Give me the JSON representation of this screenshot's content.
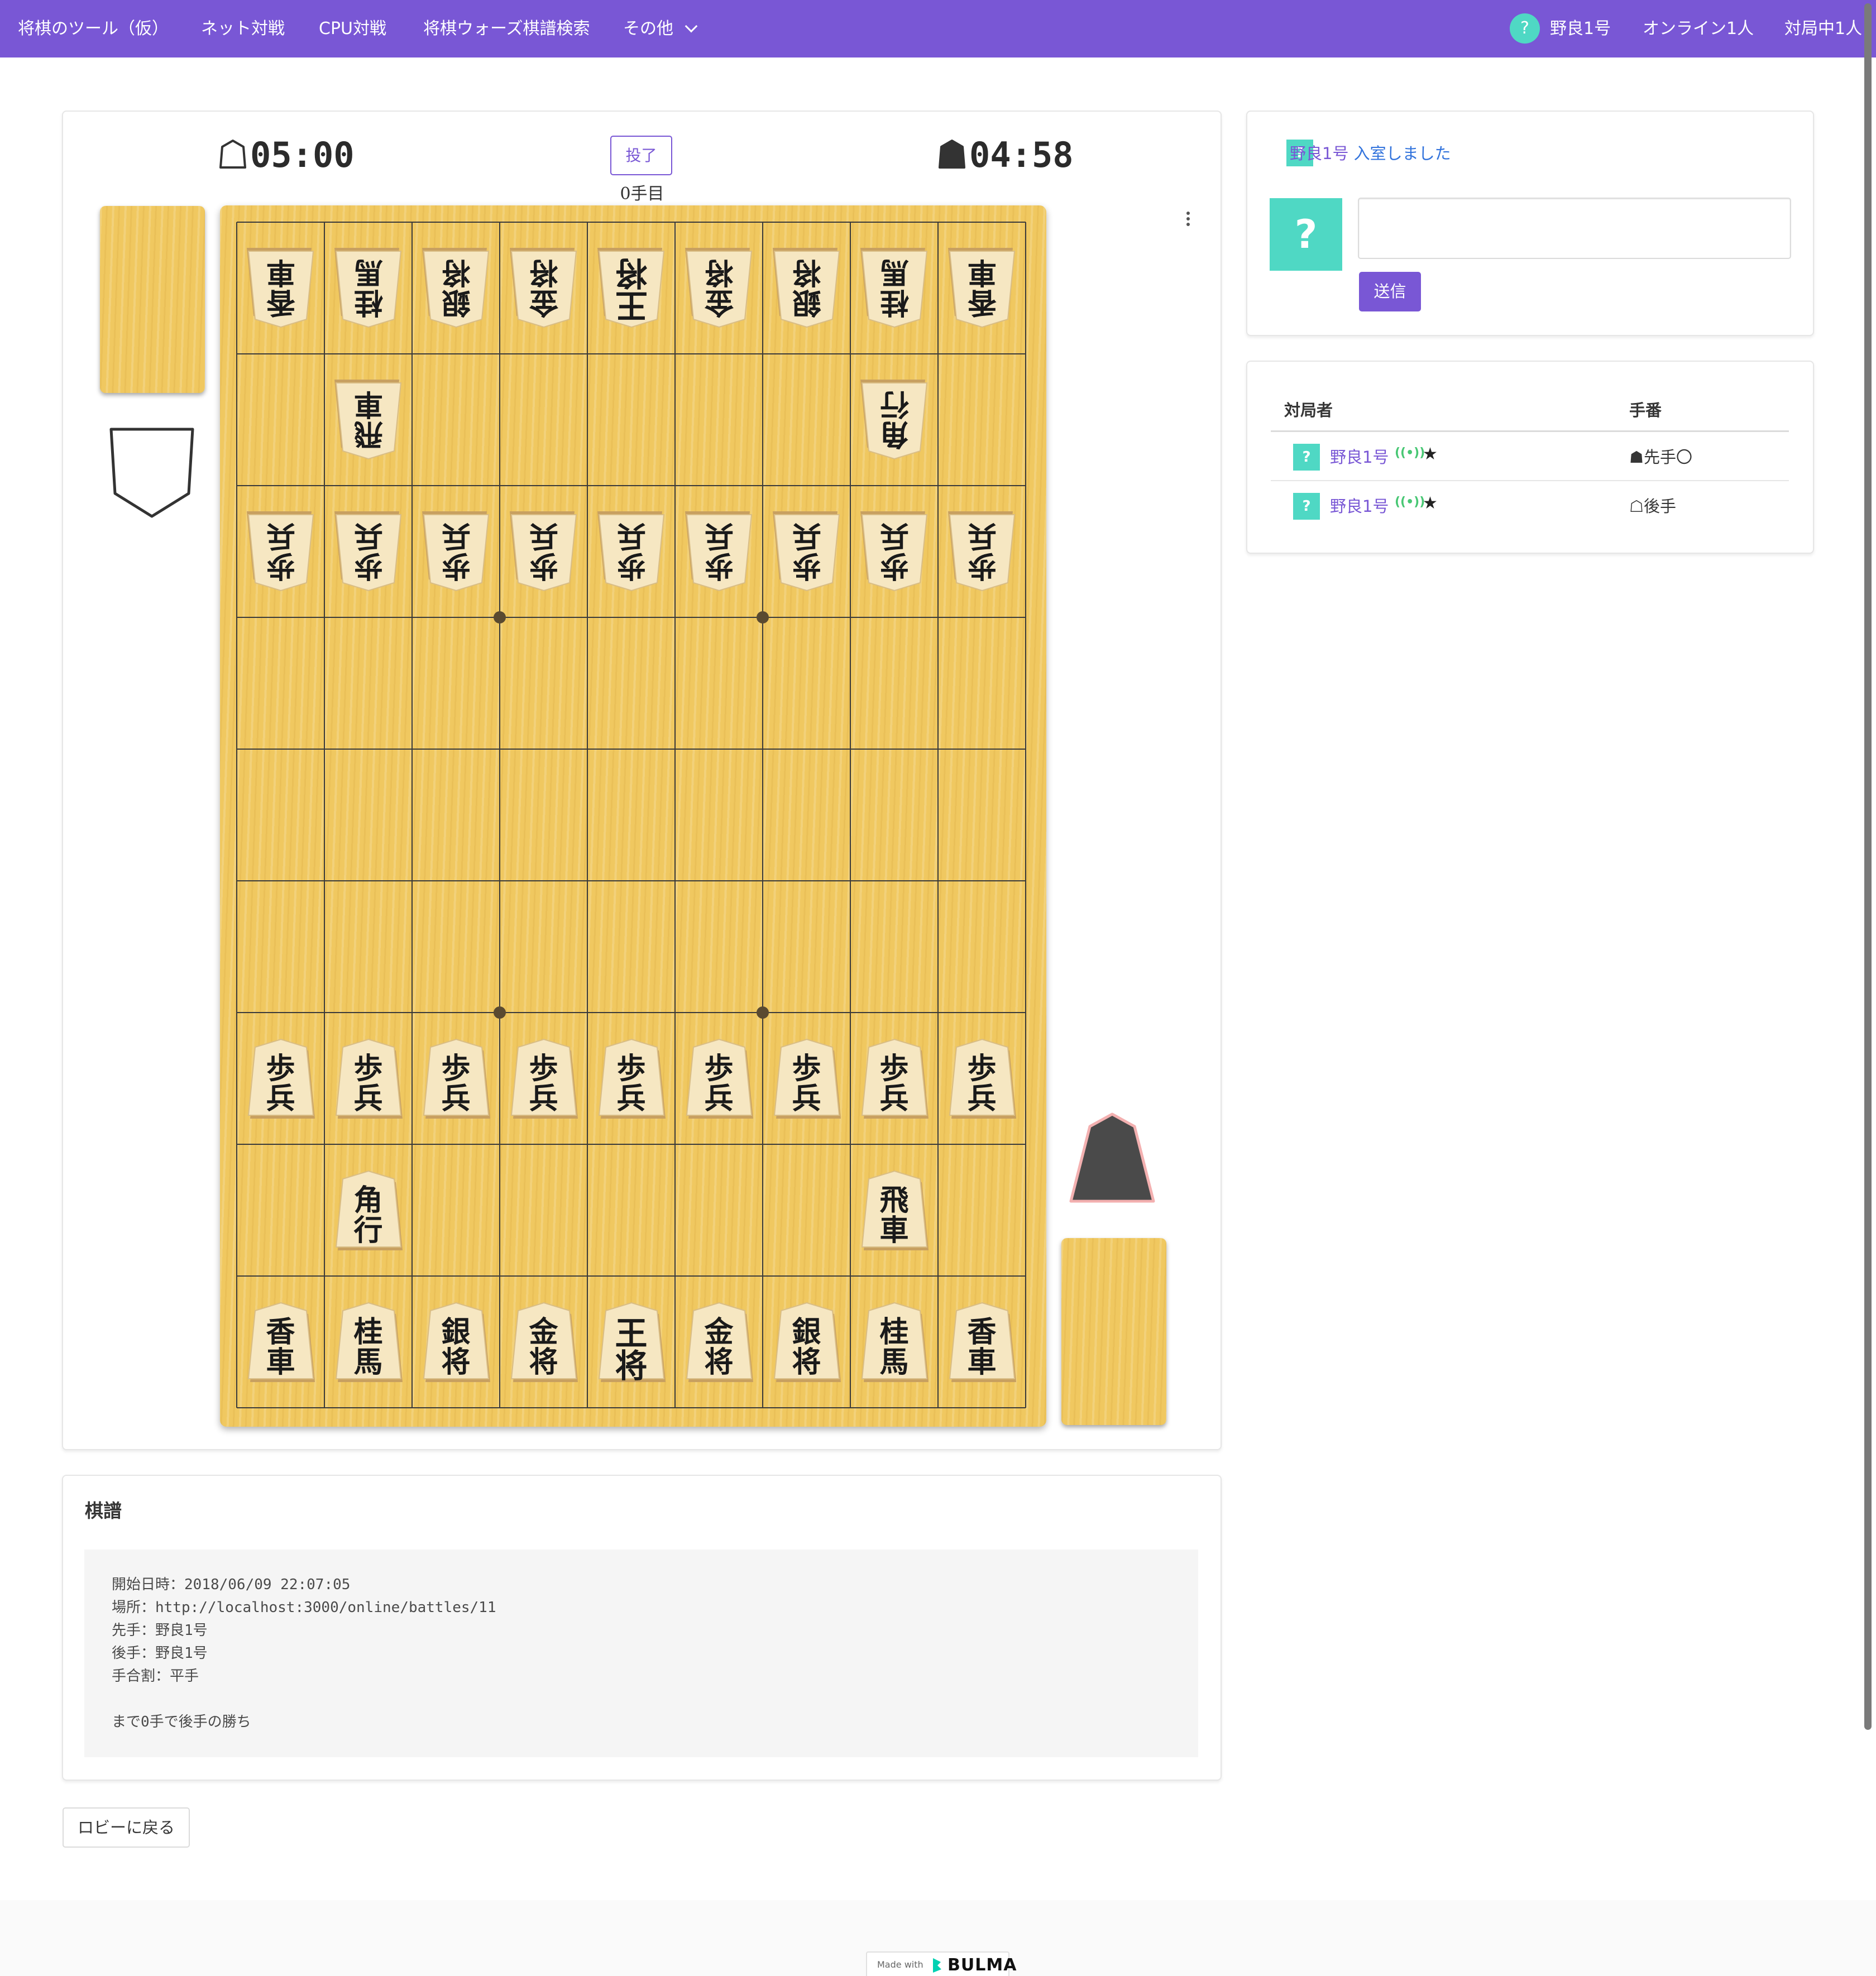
{
  "navbar": {
    "brand": "将棋のツール（仮）",
    "links": [
      "ネット対戦",
      "CPU対戦",
      "将棋ウォーズ棋譜検索",
      "その他"
    ],
    "user_icon": "?",
    "user_name": "野良1号",
    "online_count": "オンライン1人",
    "playing_count": "対局中1人"
  },
  "game": {
    "gote_clock": "05:00",
    "sente_clock": "04:58",
    "resign_label": "投了",
    "move_count": "0手目",
    "board": [
      [
        "香",
        "桂",
        "銀",
        "金",
        "王",
        "金",
        "銀",
        "桂",
        "香"
      ],
      [
        "",
        "飛",
        "",
        "",
        "",
        "",
        "",
        "角",
        ""
      ],
      [
        "歩",
        "歩",
        "歩",
        "歩",
        "歩",
        "歩",
        "歩",
        "歩",
        "歩"
      ],
      [
        "",
        "",
        "",
        "",
        "",
        "",
        "",
        "",
        ""
      ],
      [
        "",
        "",
        "",
        "",
        "",
        "",
        "",
        "",
        ""
      ],
      [
        "",
        "",
        "",
        "",
        "",
        "",
        "",
        "",
        ""
      ],
      [
        "歩",
        "歩",
        "歩",
        "歩",
        "歩",
        "歩",
        "歩",
        "歩",
        "歩"
      ],
      [
        "",
        "角",
        "",
        "",
        "",
        "",
        "",
        "飛",
        ""
      ],
      [
        "香",
        "桂",
        "銀",
        "金",
        "王",
        "金",
        "銀",
        "桂",
        "香"
      ]
    ],
    "piece_labels": {
      "香": "香\n車",
      "桂": "桂\n馬",
      "銀": "銀\n将",
      "金": "金\n将",
      "王": "王\n将",
      "飛": "飛\n車",
      "角": "角\n行",
      "歩": "歩\n兵"
    },
    "colors": {
      "accent": "#7957d5",
      "avatar": "#4fd8c4",
      "online": "#48c774",
      "link": "#3273dc"
    }
  },
  "chat": {
    "message_user": "野良1号",
    "message_text": "入室しました",
    "avatar": "?",
    "input_value": "",
    "send_label": "送信"
  },
  "players": {
    "headers": [
      "対局者",
      "手番"
    ],
    "rows": [
      {
        "avatar": "?",
        "name": "野良1号",
        "online_icon": "((•))",
        "star": "★",
        "side": "☗先手〇"
      },
      {
        "avatar": "?",
        "name": "野良1号",
        "online_icon": "((•))",
        "star": "★",
        "side": "☖後手"
      }
    ]
  },
  "kifu": {
    "title": "棋譜",
    "lines": [
      "開始日時：2018/06/09 22:07:05",
      "場所：http://localhost:3000/online/battles/11",
      "先手：野良1号",
      "後手：野良1号",
      "手合割：平手",
      "",
      "まで0手で後手の勝ち"
    ]
  },
  "lobby_button": "ロビーに戻る",
  "footer": {
    "made_with": "Made with",
    "brand": "BULMA"
  }
}
